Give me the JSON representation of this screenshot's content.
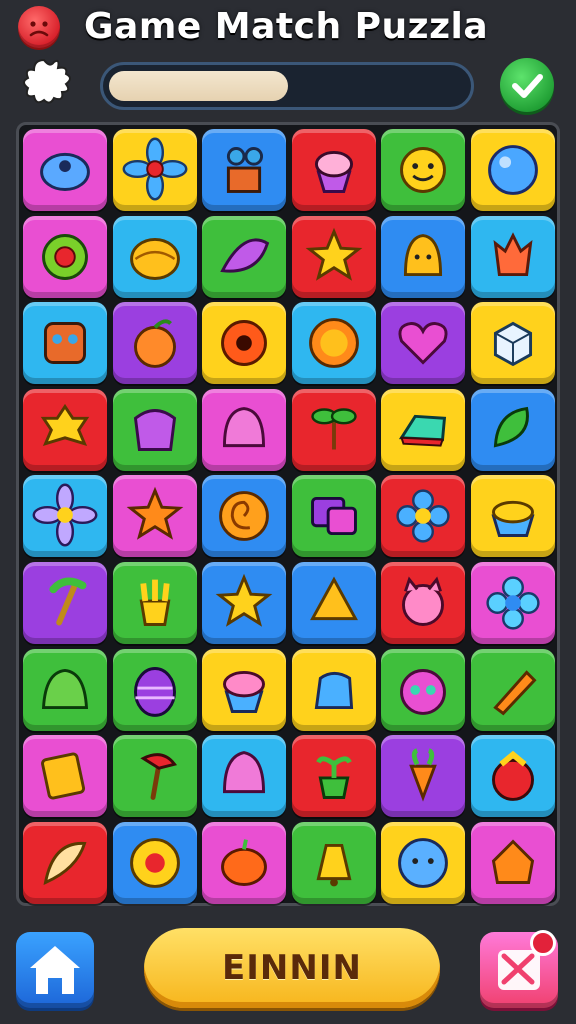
{
  "header": {
    "title": "Game Match Puzzla",
    "progress": 0.52,
    "icons": {
      "menu": "sad-face-icon",
      "splash": "paint-splash-icon",
      "confirm": "check-icon"
    }
  },
  "board": {
    "rows": 9,
    "cols": 6,
    "tiles": [
      {
        "color": "#e94fd2",
        "icon": "blob-creature"
      },
      {
        "color": "#ffd21c",
        "icon": "flower"
      },
      {
        "color": "#2f8cf2",
        "icon": "cupcake-robot"
      },
      {
        "color": "#e8262d",
        "icon": "cupcake"
      },
      {
        "color": "#3fbf3c",
        "icon": "smiley"
      },
      {
        "color": "#ffd21c",
        "icon": "ball"
      },
      {
        "color": "#e94fd2",
        "icon": "sunflower"
      },
      {
        "color": "#2fb7f0",
        "icon": "shell"
      },
      {
        "color": "#3fbf3c",
        "icon": "leaf"
      },
      {
        "color": "#e8262d",
        "icon": "star-face"
      },
      {
        "color": "#2f8cf2",
        "icon": "bell-face"
      },
      {
        "color": "#2fb7f0",
        "icon": "tulip"
      },
      {
        "color": "#2fb7f0",
        "icon": "robot-face"
      },
      {
        "color": "#9b3fe0",
        "icon": "peach"
      },
      {
        "color": "#ffd21c",
        "icon": "donut-flower"
      },
      {
        "color": "#2fb7f0",
        "icon": "sun-face"
      },
      {
        "color": "#9b3fe0",
        "icon": "heart"
      },
      {
        "color": "#ffd21c",
        "icon": "cube"
      },
      {
        "color": "#e8262d",
        "icon": "cookie-face"
      },
      {
        "color": "#3fbf3c",
        "icon": "gift"
      },
      {
        "color": "#e94fd2",
        "icon": "jelly"
      },
      {
        "color": "#e8262d",
        "icon": "sprout"
      },
      {
        "color": "#ffd21c",
        "icon": "block"
      },
      {
        "color": "#2f8cf2",
        "icon": "leaf-bunch"
      },
      {
        "color": "#2fb7f0",
        "icon": "daisy"
      },
      {
        "color": "#e94fd2",
        "icon": "star"
      },
      {
        "color": "#2f8cf2",
        "icon": "swirl"
      },
      {
        "color": "#3fbf3c",
        "icon": "photos"
      },
      {
        "color": "#e8262d",
        "icon": "flower-blue"
      },
      {
        "color": "#ffd21c",
        "icon": "pudding"
      },
      {
        "color": "#9b3fe0",
        "icon": "palm"
      },
      {
        "color": "#3fbf3c",
        "icon": "fries"
      },
      {
        "color": "#2f8cf2",
        "icon": "star-yellow"
      },
      {
        "color": "#2f8cf2",
        "icon": "triangle-face"
      },
      {
        "color": "#e8262d",
        "icon": "cat-face"
      },
      {
        "color": "#e94fd2",
        "icon": "flower-cyan"
      },
      {
        "color": "#3fbf3c",
        "icon": "slime"
      },
      {
        "color": "#3fbf3c",
        "icon": "egg"
      },
      {
        "color": "#ffd21c",
        "icon": "cupcake-pink"
      },
      {
        "color": "#ffd21c",
        "icon": "jelly-blue"
      },
      {
        "color": "#3fbf3c",
        "icon": "alien"
      },
      {
        "color": "#3fbf3c",
        "icon": "crayon"
      },
      {
        "color": "#e94fd2",
        "icon": "book"
      },
      {
        "color": "#3fbf3c",
        "icon": "axe"
      },
      {
        "color": "#2fb7f0",
        "icon": "meringue"
      },
      {
        "color": "#e8262d",
        "icon": "plant"
      },
      {
        "color": "#9b3fe0",
        "icon": "carrot"
      },
      {
        "color": "#2fb7f0",
        "icon": "fruit-basket"
      },
      {
        "color": "#e8262d",
        "icon": "feather"
      },
      {
        "color": "#2f8cf2",
        "icon": "sunflower-red"
      },
      {
        "color": "#e94fd2",
        "icon": "pumpkin"
      },
      {
        "color": "#3fbf3c",
        "icon": "bell"
      },
      {
        "color": "#ffd21c",
        "icon": "planet-face"
      },
      {
        "color": "#e94fd2",
        "icon": "house-face"
      }
    ]
  },
  "footer": {
    "main_button_label": "EINNIN",
    "icons": {
      "home": "home-icon",
      "shuffle": "shuffle-icon"
    }
  }
}
